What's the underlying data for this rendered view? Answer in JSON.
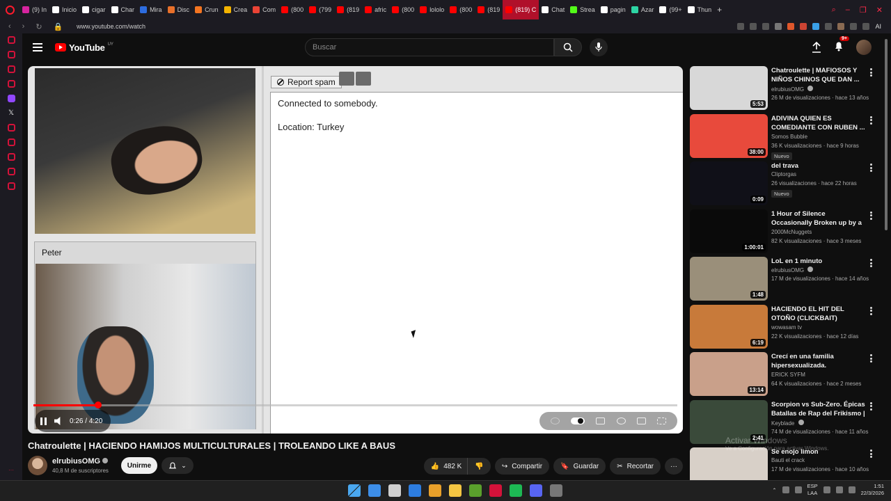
{
  "browser": {
    "tabs": [
      {
        "label": "(9) In",
        "color": "#d6249f"
      },
      {
        "label": "Inicio",
        "color": "#ffffff"
      },
      {
        "label": "cigar",
        "color": "#ffffff"
      },
      {
        "label": "Char",
        "color": "#ffffff"
      },
      {
        "label": "Mira",
        "color": "#2d6cdf"
      },
      {
        "label": "Disc",
        "color": "#e8702a"
      },
      {
        "label": "Crun",
        "color": "#f47521"
      },
      {
        "label": "Crea",
        "color": "#f4b400"
      },
      {
        "label": "Com",
        "color": "#ea4335"
      },
      {
        "label": "(800",
        "color": "#ff0000"
      },
      {
        "label": "(799",
        "color": "#ff0000"
      },
      {
        "label": "(819",
        "color": "#ff0000"
      },
      {
        "label": "afric",
        "color": "#ff0000"
      },
      {
        "label": "(800",
        "color": "#ff0000"
      },
      {
        "label": "lololo",
        "color": "#ff0000"
      },
      {
        "label": "(800",
        "color": "#ff0000"
      },
      {
        "label": "(819",
        "color": "#ff0000"
      },
      {
        "label": "(819) C",
        "color": "#ff0000",
        "active": true
      },
      {
        "label": "Chat",
        "color": "#ffffff"
      },
      {
        "label": "Strea",
        "color": "#53fc18"
      },
      {
        "label": "pagin",
        "color": "#ffffff"
      },
      {
        "label": "Azar",
        "color": "#2dd4a4"
      },
      {
        "label": "(99+",
        "color": "#ffffff"
      },
      {
        "label": "Thun",
        "color": "#ffffff"
      }
    ],
    "new_tab": "+",
    "url": "www.youtube.com/watch",
    "ext_label": "AI"
  },
  "header": {
    "logo_text": "YouTube",
    "logo_region": "UY",
    "search_placeholder": "Buscar",
    "notif_count": "9+"
  },
  "player": {
    "report_label": "Report spam",
    "chat_lines": [
      "Connected to somebody.",
      "Location: Turkey"
    ],
    "stranger_name": "Peter",
    "time_current": "0:26",
    "time_total": "4:20",
    "progress_fraction": 0.1
  },
  "video": {
    "title": "Chatroulette | HACIENDO HAMIJOS MULTICULTURALES | TROLEANDO LIKE A BAUS",
    "channel": "elrubiusOMG",
    "subscribers": "40,8 M de suscriptores",
    "join_label": "Unirme",
    "likes": "482 K",
    "share_label": "Compartir",
    "save_label": "Guardar",
    "clip_label": "Recortar"
  },
  "related": [
    {
      "title": "Chatroulette | MAFIOSOS Y NIÑOS CHINOS QUE DAN ...",
      "channel": "elrubiusOMG",
      "verified": true,
      "meta": "26 M de visualizaciones · hace 13 años",
      "duration": "5:53",
      "thumb": "#d8d8d8"
    },
    {
      "title": "ADIVINA QUIEN ES COMEDIANTE CON RUBEN ...",
      "channel": "Somos Bubble",
      "verified": false,
      "meta": "36 K visualizaciones · hace 9 horas",
      "duration": "38:00",
      "badge": "Nuevo",
      "thumb": "#e84a3c"
    },
    {
      "title": "del trava",
      "channel": "Cliptorgas",
      "verified": false,
      "meta": "26 visualizaciones · hace 22 horas",
      "duration": "0:09",
      "badge": "Nuevo",
      "thumb": "#101018"
    },
    {
      "title": "1 Hour of Silence Occasionally Broken up by a skeleton runni...",
      "channel": "2000McNuggets",
      "verified": false,
      "meta": "82 K visualizaciones · hace 3 meses",
      "duration": "1:00:01",
      "thumb": "#0a0a0a"
    },
    {
      "title": "LoL en 1 minuto",
      "channel": "elrubiusOMG",
      "verified": true,
      "meta": "17 M de visualizaciones · hace 14 años",
      "duration": "1:48",
      "thumb": "#9a8f7a"
    },
    {
      "title": "HACIENDO EL HIT DEL OTOÑO (CLICKBAIT) @melianvalen ...",
      "channel": "wowasam tv",
      "verified": false,
      "meta": "22 K visualizaciones · hace 12 días",
      "duration": "6:19",
      "thumb": "#c87a3a"
    },
    {
      "title": "Crecí en una familia hipersexualizada.",
      "channel": "ERICK SYFM",
      "verified": false,
      "meta": "64 K visualizaciones · hace 2 meses",
      "duration": "13:14",
      "thumb": "#c9a08a"
    },
    {
      "title": "Scorpion vs Sub-Zero. Épicas Batallas de Rap del Frikismo | ...",
      "channel": "Keyblade",
      "verified": true,
      "meta": "74 M de visualizaciones · hace 11 años",
      "duration": "2:41",
      "thumb": "#3a4a3a"
    },
    {
      "title": "Se enojo limon",
      "channel": "Bauti el crack",
      "verified": false,
      "meta": "17 M de visualizaciones · hace 10 años",
      "duration": "",
      "thumb": "#d8d0c8"
    }
  ],
  "watermark": {
    "line1": "Activar Windows",
    "line2": "Ve a Configuración para activar Windows."
  },
  "taskbar": {
    "apps": [
      "#3d8ee8",
      "#cfcfcf",
      "#2d7de0",
      "#e8a02a",
      "#f4c542",
      "#5aa02c",
      "#d4123a",
      "#1db954",
      "#5865f2",
      "#777777"
    ],
    "lang": "ESP",
    "lang2": "LAA",
    "time": "1:51",
    "date": "22/3/2026"
  }
}
